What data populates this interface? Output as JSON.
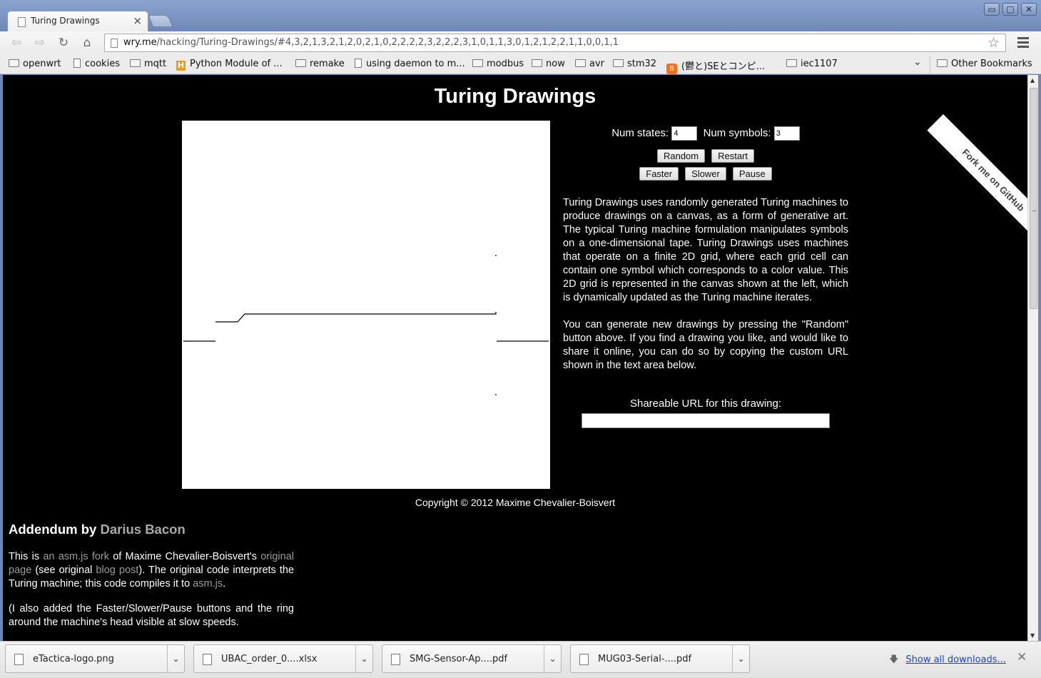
{
  "browser": {
    "tab_title": "Turing Drawings",
    "tab_close": "×",
    "window_controls": {
      "minimize": "▭",
      "maximize": "□",
      "close": "✕"
    },
    "nav": {
      "back": "⇦",
      "forward": "⇨",
      "reload": "↻",
      "home": "⌂"
    },
    "url_host": "wry.me",
    "url_path": "/hacking/Turing-Drawings/#4,3,2,1,3,2,1,2,0,2,1,0,2,2,2,2,3,2,2,2,3,1,0,1,1,3,0,1,2,1,2,2,1,1,0,0,1,1",
    "star": "☆"
  },
  "bookmarks": [
    {
      "label": "openwrt",
      "icon": "folder-icon"
    },
    {
      "label": "cookies",
      "icon": "page-icon"
    },
    {
      "label": "mqtt",
      "icon": "folder-icon"
    },
    {
      "label": "Python Module of ...",
      "icon": "hacker-news-icon"
    },
    {
      "label": "remake",
      "icon": "folder-icon"
    },
    {
      "label": "using daemon to m...",
      "icon": "page-icon"
    },
    {
      "label": "modbus",
      "icon": "folder-icon"
    },
    {
      "label": "now",
      "icon": "folder-icon"
    },
    {
      "label": "avr",
      "icon": "folder-icon"
    },
    {
      "label": "stm32",
      "icon": "folder-icon"
    },
    {
      "label": "(鬱と)SEとコンピ...",
      "icon": "blogger-icon"
    },
    {
      "label": "iec1107",
      "icon": "folder-icon"
    }
  ],
  "bookmarks_overflow": "⌄",
  "other_bookmarks": "Other Bookmarks",
  "page": {
    "title": "Turing Drawings",
    "ribbon": "Fork me on GitHub",
    "num_states_label": "Num states:",
    "num_states_value": "4",
    "num_symbols_label": "Num symbols:",
    "num_symbols_value": "3",
    "buttons": {
      "random": "Random",
      "restart": "Restart",
      "faster": "Faster",
      "slower": "Slower",
      "pause": "Pause"
    },
    "description_1": "Turing Drawings uses randomly generated Turing machines to produce drawings on a canvas, as a form of generative art. The typical Turing machine formulation manipulates symbols on a one-dimensional tape. Turing Drawings uses machines that operate on a finite 2D grid, where each grid cell can contain one symbol which corresponds to a color value. This 2D grid is represented in the canvas shown at the left, which is dynamically updated as the Turing machine iterates.",
    "description_2": "You can generate new drawings by pressing the \"Random\" button above. If you find a drawing you like, and would like to share it online, you can do so by copying the custom URL shown in the text area below.",
    "share_label": "Shareable URL for this drawing:",
    "share_value": "",
    "copyright": "Copyright © 2012 Maxime Chevalier-Boisvert",
    "addendum_title": "Addendum by ",
    "addendum_author": "Darius Bacon",
    "addendum_p1": {
      "t1": "This is ",
      "l1": "an asm.js fork",
      "t2": " of Maxime Chevalier-Boisvert's ",
      "l2": "original page",
      "t3": " (see original ",
      "l3": "blog post",
      "t4": "). The original code interprets the Turing machine; this code compiles it to ",
      "l4": "asm.js",
      "t5": "."
    },
    "addendum_p2": "(I also added the Faster/Slower/Pause buttons and the ring around the machine's head visible at slow speeds."
  },
  "downloads": {
    "items": [
      {
        "name": "eTactica-logo.png",
        "icon": "image-file-icon"
      },
      {
        "name": "UBAC_order_0....xlsx",
        "icon": "spreadsheet-file-icon"
      },
      {
        "name": "SMG-Sensor-Ap....pdf",
        "icon": "pdf-file-icon"
      },
      {
        "name": "MUG03-Serial-....pdf",
        "icon": "pdf-file-icon"
      }
    ],
    "item_menu": "⌄",
    "show_all": "Show all downloads...",
    "close": "✕"
  },
  "colors": {
    "page_background": "#000000",
    "canvas_background": "#ffffff",
    "drawing_ink": "#000000",
    "link": "#9a9a9a",
    "download_link": "#1a45c6",
    "window_frame": "#6d86b3"
  }
}
